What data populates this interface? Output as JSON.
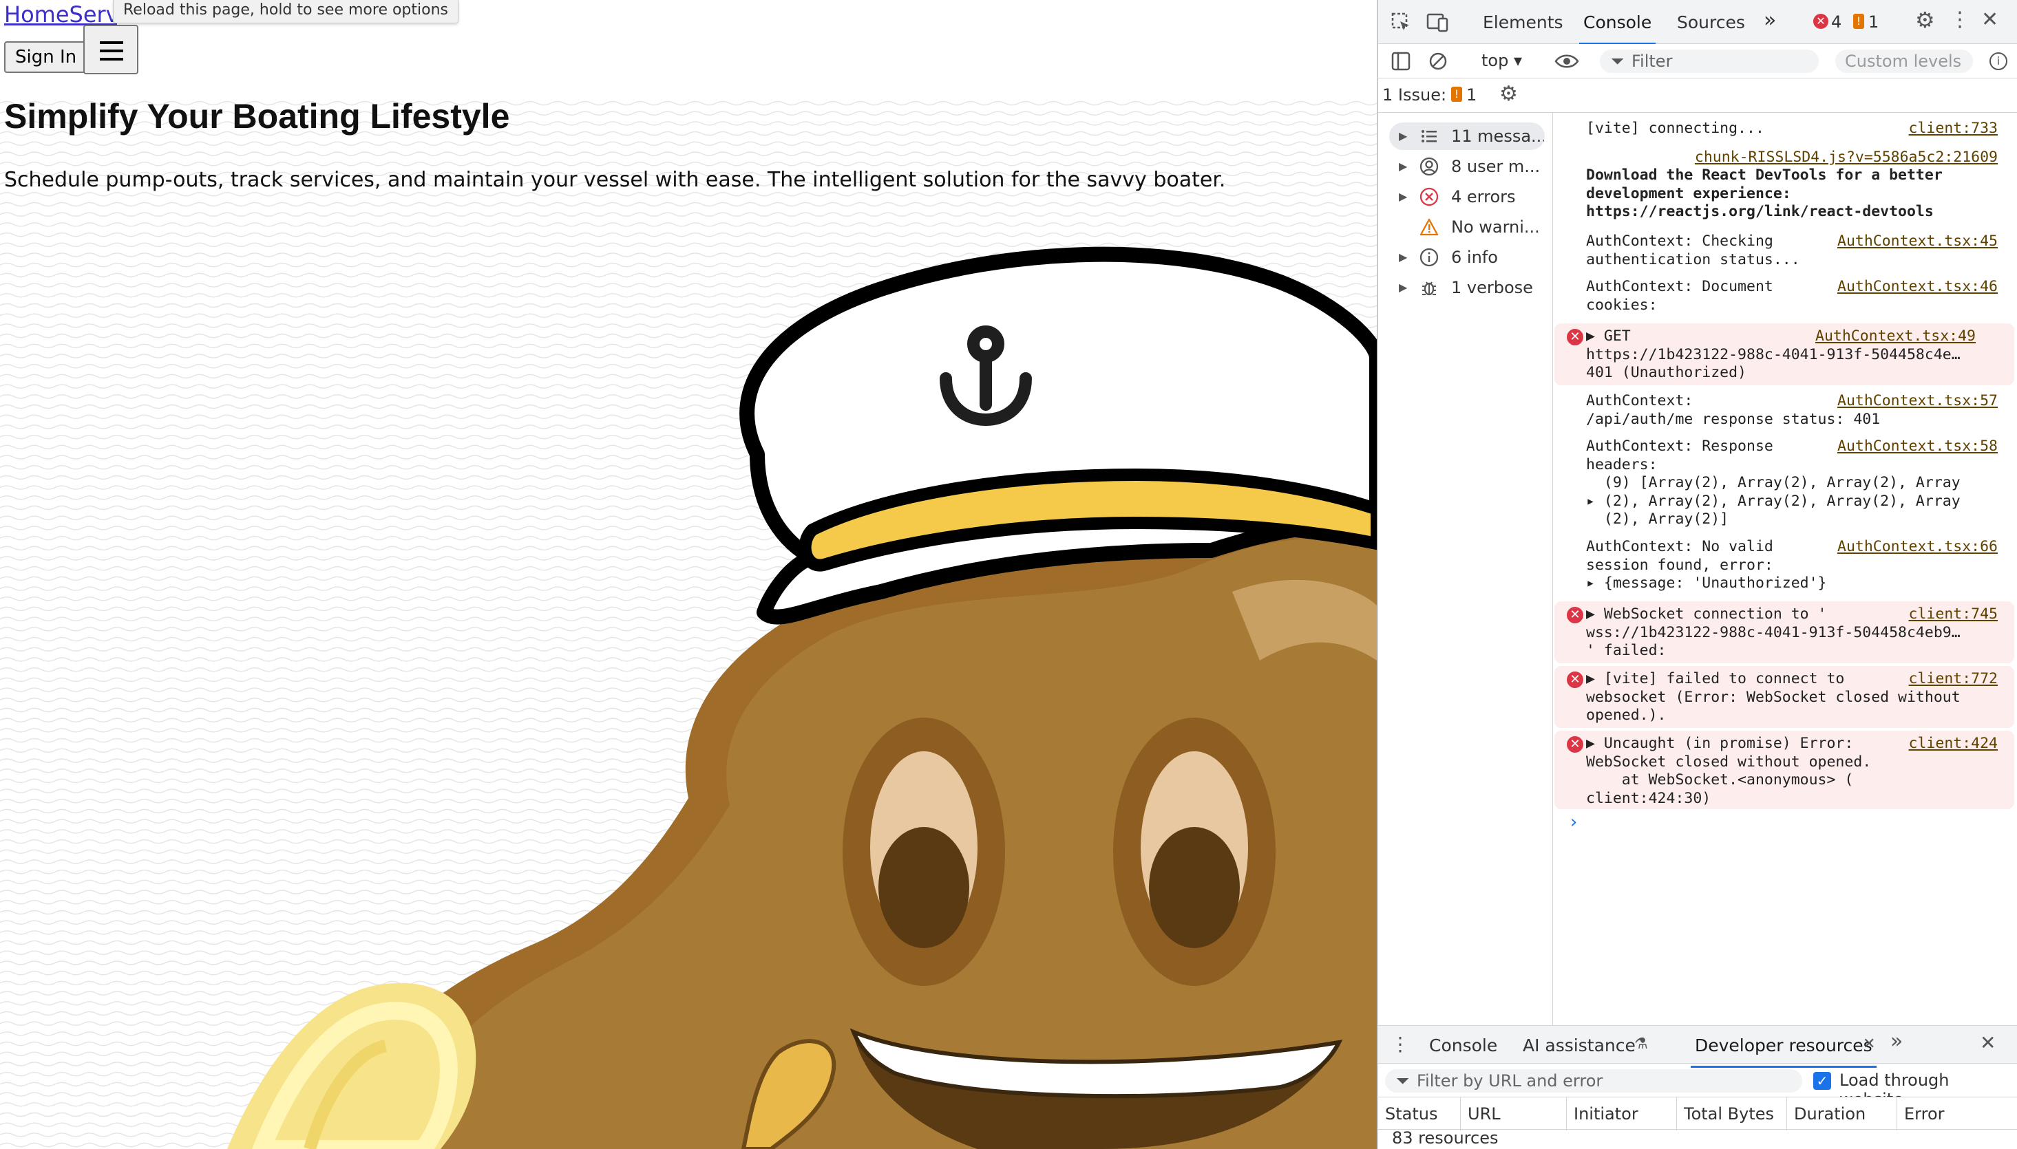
{
  "page": {
    "brand": "HomeServi",
    "tooltip": "Reload this page, hold to see more options",
    "sign_in": "Sign In",
    "hero_title": "Simplify Your Boating Lifestyle",
    "hero_subtitle": "Schedule pump-outs, track services, and maintain your vessel with ease. The intelligent solution for the savvy boater."
  },
  "devtools": {
    "tabs": [
      "Elements",
      "Console",
      "Sources"
    ],
    "more_tabs": "»",
    "error_count": "4",
    "issue_count": "1",
    "context": "top",
    "filter_placeholder": "Filter",
    "levels": "Custom levels",
    "issues_label": "1 Issue:",
    "issues_count": "1",
    "sidebar": [
      {
        "label": "11 messa...",
        "icon": "list-icon"
      },
      {
        "label": "8 user m...",
        "icon": "user-icon"
      },
      {
        "label": "4 errors",
        "icon": "error-icon"
      },
      {
        "label": "No warni...",
        "icon": "warning-icon"
      },
      {
        "label": "6 info",
        "icon": "info-icon"
      },
      {
        "label": "1 verbose",
        "icon": "bug-icon"
      }
    ],
    "messages": [
      {
        "text": "[vite] connecting...",
        "link": "client:733"
      },
      {
        "link": "chunk-RISSLSD4.js?v=5586a5c2:21609",
        "text": "Download the React DevTools for a better\ndevelopment experience:\nhttps://reactjs.org/link/react-devtools"
      },
      {
        "text": "AuthContext: Checking\nauthentication status...",
        "link": "AuthContext.tsx:45"
      },
      {
        "text": "AuthContext: Document\ncookies:",
        "link": "AuthContext.tsx:46"
      },
      {
        "text": "▶ GET\nhttps://1b423122-988c-4041-913f-504458c4e…\n401 (Unauthorized)",
        "link": "AuthContext.tsx:49"
      },
      {
        "text": "AuthContext:\n/api/auth/me response status: 401",
        "link": "AuthContext.tsx:57"
      },
      {
        "text": "AuthContext: Response\nheaders:\n  (9) [Array(2), Array(2), Array(2), Array\n▸ (2), Array(2), Array(2), Array(2), Array\n  (2), Array(2)]",
        "link": "AuthContext.tsx:58"
      },
      {
        "text": "AuthContext: No valid\nsession found, error:\n▸ {message: 'Unauthorized'}",
        "link": "AuthContext.tsx:66"
      },
      {
        "text": "▶ WebSocket connection to '\nwss://1b423122-988c-4041-913f-504458c4eb9…\n' failed:",
        "link": "client:745"
      },
      {
        "text": "▶ [vite] failed to connect to\nwebsocket (Error: WebSocket closed without\nopened.).",
        "link": "client:772"
      },
      {
        "text": "▶ Uncaught (in promise) Error:\nWebSocket closed without opened.\n    at WebSocket.<anonymous> (\nclient:424:30)",
        "link": "client:424"
      }
    ],
    "prompt": "›",
    "drawer_tabs": [
      "Console",
      "AI assistance",
      "Developer resources"
    ],
    "drawer_filter_placeholder": "Filter by URL and error",
    "load_through_website": "Load through website",
    "columns": [
      "Status",
      "URL",
      "Initiator",
      "Total Bytes",
      "Duration",
      "Error"
    ],
    "resources_count": "83 resources"
  }
}
